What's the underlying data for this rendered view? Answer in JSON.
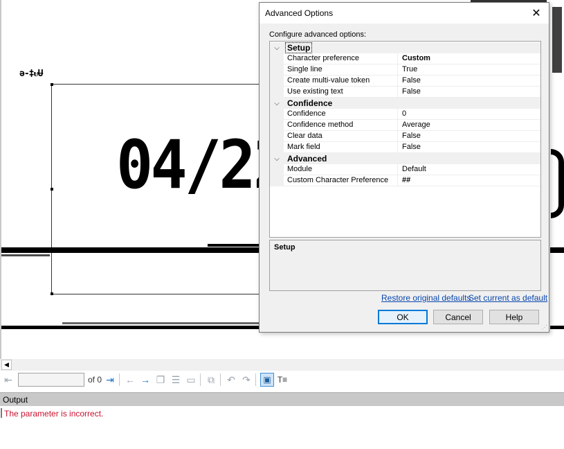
{
  "document": {
    "date_fragment": "04/22",
    "small_text": "ǝ-‡ᵾɄ"
  },
  "navbar": {
    "page_field_value": "",
    "of_label": "of 0"
  },
  "output": {
    "header": "Output",
    "message": "The parameter is incorrect."
  },
  "dialog": {
    "title": "Advanced Options",
    "caption": "Configure advanced options:",
    "categories": [
      {
        "label": "Setup",
        "properties": [
          {
            "name": "Character preference",
            "value": "Custom"
          },
          {
            "name": "Single line",
            "value": "True"
          },
          {
            "name": "Create multi-value token",
            "value": "False"
          },
          {
            "name": "Use existing text",
            "value": "False"
          }
        ]
      },
      {
        "label": "Confidence",
        "properties": [
          {
            "name": "Confidence",
            "value": "0"
          },
          {
            "name": "Confidence method",
            "value": "Average"
          },
          {
            "name": "Clear data",
            "value": "False"
          },
          {
            "name": "Mark field",
            "value": "False"
          }
        ]
      },
      {
        "label": "Advanced",
        "properties": [
          {
            "name": "Module",
            "value": "Default"
          },
          {
            "name": "Custom Character Preference",
            "value": "##"
          }
        ]
      }
    ],
    "description_title": "Setup",
    "restore_link": "Restore original defaults",
    "set_default_link": "Set current as default",
    "ok_label": "OK",
    "cancel_label": "Cancel",
    "help_label": "Help"
  },
  "colors": {
    "accent": "#0078d7",
    "error": "#c8102e",
    "link": "#0645ad"
  }
}
